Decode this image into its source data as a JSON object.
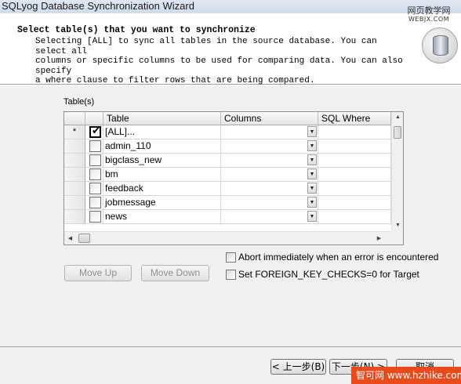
{
  "window": {
    "title": "SQLyog Database Synchronization Wizard"
  },
  "watermark_top": {
    "line1": "网页教学网",
    "line2": "WEBJX.COM"
  },
  "header": {
    "heading": "Select table(s) that you want to synchronize",
    "description_lines": [
      "Selecting [ALL] to sync all tables in the source database. You can select all",
      "columns or specific columns to be used for comparing data. You can also specify",
      "a where clause to filter rows that are being compared."
    ],
    "icon": "database-sync-icon"
  },
  "tables_label": "Table(s)",
  "grid": {
    "columns": [
      "Table",
      "Columns",
      "SQL Where"
    ],
    "rows": [
      {
        "marker": "*",
        "checked": true,
        "table": "[ALL]..."
      },
      {
        "marker": "",
        "checked": false,
        "table": "admin_110"
      },
      {
        "marker": "",
        "checked": false,
        "table": "bigclass_new"
      },
      {
        "marker": "",
        "checked": false,
        "table": "bm"
      },
      {
        "marker": "",
        "checked": false,
        "table": "feedback"
      },
      {
        "marker": "",
        "checked": false,
        "table": "jobmessage"
      },
      {
        "marker": "",
        "checked": false,
        "table": "news"
      }
    ]
  },
  "buttons": {
    "move_up": "Move Up",
    "move_down": "Move Down"
  },
  "options": {
    "abort_on_error": "Abort immediately when an error is encountered",
    "fk_checks": "Set FOREIGN_KEY_CHECKS=0 for Target"
  },
  "nav": {
    "back": "< 上一步(B)",
    "next": "下一步(N) >",
    "cancel": "取消"
  },
  "watermark_bottom": "智可网 www.hzhike.com"
}
